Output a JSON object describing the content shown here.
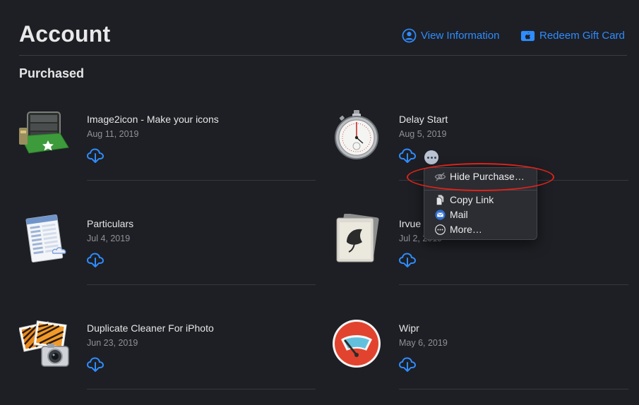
{
  "header": {
    "title": "Account",
    "view_information": "View Information",
    "redeem_gift_card": "Redeem Gift Card",
    "accent_color": "#2f8cff"
  },
  "section": {
    "title": "Purchased"
  },
  "purchases": [
    {
      "name": "Image2icon - Make your icons",
      "date": "Aug 11, 2019",
      "icon": "image2icon-app-icon"
    },
    {
      "name": "Delay Start",
      "date": "Aug 5, 2019",
      "icon": "stopwatch-app-icon"
    },
    {
      "name": "Particulars",
      "date": "Jul 4, 2019",
      "icon": "particulars-app-icon"
    },
    {
      "name": "Irvue",
      "date": "Jul 2, 2019",
      "icon": "irvue-app-icon"
    },
    {
      "name": "Duplicate Cleaner For iPhoto",
      "date": "Jun 23, 2019",
      "icon": "duplicate-cleaner-app-icon"
    },
    {
      "name": "Wipr",
      "date": "May 6, 2019",
      "icon": "wipr-app-icon"
    }
  ],
  "context_menu": {
    "items": [
      {
        "label": "Hide Purchase…",
        "icon": "eye-slash-icon"
      },
      {
        "label": "Copy Link",
        "icon": "copy-doc-icon"
      },
      {
        "label": "Mail",
        "icon": "mail-icon"
      },
      {
        "label": "More…",
        "icon": "ellipsis-circle-icon"
      }
    ],
    "highlight_color": "#e0221a"
  }
}
